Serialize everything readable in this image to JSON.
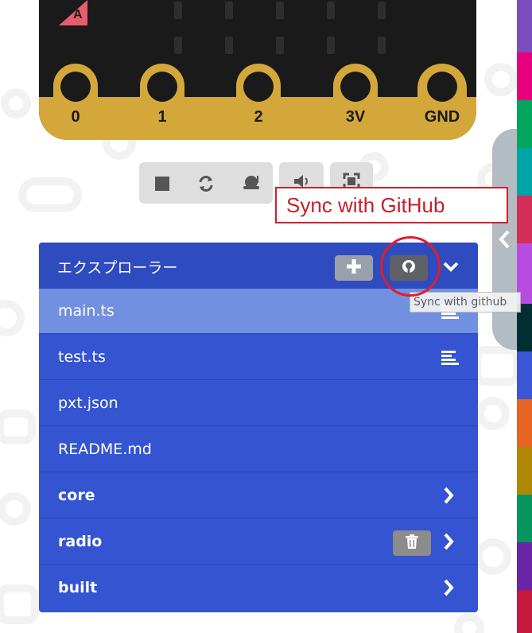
{
  "board": {
    "button_a_label": "A",
    "pins": [
      "0",
      "1",
      "2",
      "3V",
      "GND"
    ]
  },
  "sim_toolbar": {
    "buttons": [
      {
        "name": "stop",
        "icon": "stop-icon"
      },
      {
        "name": "restart",
        "icon": "refresh-icon"
      },
      {
        "name": "slow-mo",
        "icon": "snail-icon"
      },
      {
        "name": "mute",
        "icon": "volume-icon"
      },
      {
        "name": "fullscreen",
        "icon": "fullscreen-icon"
      }
    ]
  },
  "annotation": {
    "callout_text": "Sync with GitHub"
  },
  "explorer": {
    "title": "エクスプローラー",
    "add_icon": "plus-icon",
    "sync_icon": "github-icon",
    "collapse_icon": "chevron-down-icon",
    "tooltip": "Sync with github",
    "items": [
      {
        "label": "main.ts",
        "selected": true,
        "icon": "lines-icon"
      },
      {
        "label": "test.ts",
        "icon": "lines-icon"
      },
      {
        "label": "pxt.json"
      },
      {
        "label": "README.md"
      },
      {
        "label": "core",
        "bold": true,
        "icon": "chevron-right-icon"
      },
      {
        "label": "radio",
        "bold": true,
        "icon": "chevron-right-icon",
        "extra_icon": "trash-icon"
      },
      {
        "label": "built",
        "bold": true,
        "icon": "chevron-right-icon"
      }
    ]
  },
  "colors": {
    "explorer_bg": "#3454d1",
    "explorer_header": "#2e4bbf",
    "selected_row": "#7290e0",
    "board_gold": "#d4a73a",
    "annotation_red": "#d21f2b",
    "category_stripes": [
      "#7c4dbd",
      "#e6007e",
      "#00a65c",
      "#00a4a6",
      "#d32e56",
      "#b64de0",
      "#002e33",
      "#3b56d6",
      "#e76422",
      "#b08806",
      "#06945f",
      "#6b24a6",
      "#c4183c"
    ]
  }
}
